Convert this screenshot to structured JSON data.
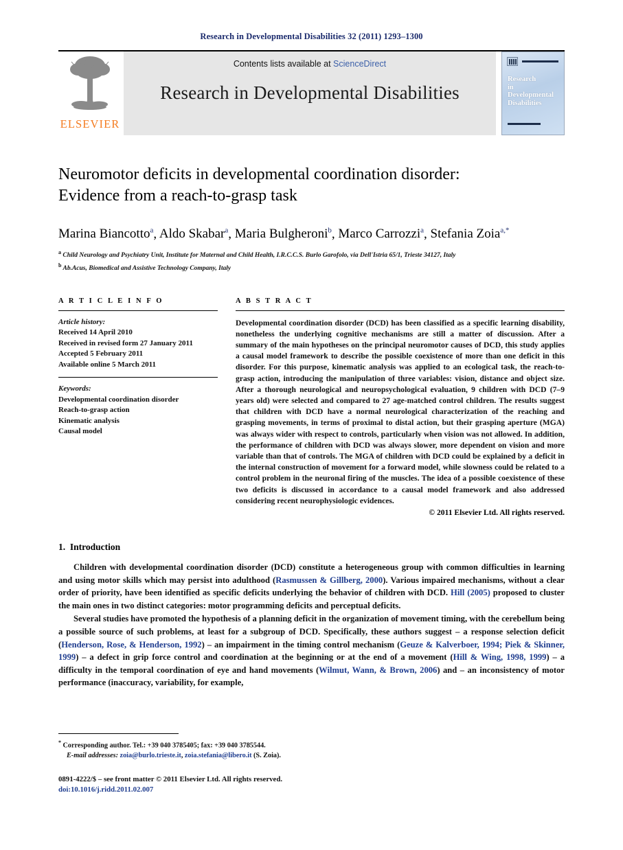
{
  "running_head": "Research in Developmental Disabilities 32 (2011) 1293–1300",
  "masthead": {
    "contents_prefix": "Contents lists available at ",
    "sciencedirect": "ScienceDirect",
    "journal_title": "Research in Developmental Disabilities",
    "publisher_wordmark": "ELSEVIER",
    "cover_title_lines": [
      "Research",
      "in",
      "Developmental",
      "Disabilities"
    ],
    "accent_orange": "#f47b20",
    "link_blue": "#3b5fa8"
  },
  "article": {
    "title_line1": "Neuromotor deficits in developmental coordination disorder:",
    "title_line2": "Evidence from a reach-to-grasp task",
    "authors": [
      {
        "name": "Marina Biancotto",
        "sup": "a",
        "sep": ", "
      },
      {
        "name": "Aldo Skabar",
        "sup": "a",
        "sep": ", "
      },
      {
        "name": "Maria Bulgheroni",
        "sup": "b",
        "sep": ", "
      },
      {
        "name": "Marco Carrozzi",
        "sup": "a",
        "sep": ", "
      },
      {
        "name": "Stefania Zoia",
        "sup": "a,*",
        "sep": ""
      }
    ],
    "affiliations": [
      {
        "marker": "a",
        "text": "Child Neurology and Psychiatry Unit, Institute for Maternal and Child Health, I.R.C.C.S. Burlo Garofolo, via Dell'Istria 65/1, Trieste 34127, Italy"
      },
      {
        "marker": "b",
        "text": "Ab.Acus, Biomedical and Assistive Technology Company, Italy"
      }
    ]
  },
  "article_info": {
    "heading": "A R T I C L E   I N F O",
    "history_label": "Article history:",
    "history": [
      "Received 14 April 2010",
      "Received in revised form 27 January 2011",
      "Accepted 5 February 2011",
      "Available online 5 March 2011"
    ],
    "keywords_label": "Keywords:",
    "keywords": [
      "Developmental coordination disorder",
      "Reach-to-grasp action",
      "Kinematic analysis",
      "Causal model"
    ]
  },
  "abstract": {
    "heading": "A B S T R A C T",
    "text": "Developmental coordination disorder (DCD) has been classified as a specific learning disability, nonetheless the underlying cognitive mechanisms are still a matter of discussion. After a summary of the main hypotheses on the principal neuromotor causes of DCD, this study applies a causal model framework to describe the possible coexistence of more than one deficit in this disorder. For this purpose, kinematic analysis was applied to an ecological task, the reach-to-grasp action, introducing the manipulation of three variables: vision, distance and object size. After a thorough neurological and neuropsychological evaluation, 9 children with DCD (7–9 years old) were selected and compared to 27 age-matched control children. The results suggest that children with DCD have a normal neurological characterization of the reaching and grasping movements, in terms of proximal to distal action, but their grasping aperture (MGA) was always wider with respect to controls, particularly when vision was not allowed. In addition, the performance of children with DCD was always slower, more dependent on vision and more variable than that of controls. The MGA of children with DCD could be explained by a deficit in the internal construction of movement for a forward model, while slowness could be related to a control problem in the neuronal firing of the muscles. The idea of a possible coexistence of these two deficits is discussed in accordance to a causal model framework and also addressed considering recent neurophysiologic evidences.",
    "copyright": "© 2011 Elsevier Ltd. All rights reserved."
  },
  "introduction": {
    "number": "1.",
    "title": "Introduction",
    "paragraph1": {
      "part1": "Children with developmental coordination disorder (DCD) constitute a heterogeneous group with common difficulties in learning and using motor skills which may persist into adulthood (",
      "cite1": "Rasmussen & Gillberg, 2000",
      "part2": "). Various impaired mechanisms, without a clear order of priority, have been identified as specific deficits underlying the behavior of children with DCD. ",
      "cite2": "Hill (2005)",
      "part3": " proposed to cluster the main ones in two distinct categories: motor programming deficits and perceptual deficits."
    },
    "paragraph2": {
      "part1": "Several studies have promoted the hypothesis of a planning deficit in the organization of movement timing, with the cerebellum being a possible source of such problems, at least for a subgroup of DCD. Specifically, these authors suggest – a response selection deficit (",
      "cite1": "Henderson, Rose, & Henderson, 1992",
      "part2": ") – an impairment in the timing control mechanism (",
      "cite2": "Geuze & Kalverboer, 1994; Piek & Skinner, 1999",
      "part3": ") – a defect in grip force control and coordination at the beginning or at the end of a movement (",
      "cite3": "Hill & Wing, 1998, 1999",
      "part4": ") – a difficulty in the temporal coordination of eye and hand movements (",
      "cite4": "Wilmut, Wann, & Brown, 2006",
      "part5": ") and – an inconsistency of motor performance (inaccuracy, variability, for example,"
    }
  },
  "footnotes": {
    "corresponding_marker": "*",
    "corresponding": "Corresponding author. Tel.: +39 040 3785405; fax: +39 040 3785544.",
    "email_label": "E-mail addresses:",
    "email1": "zoia@burlo.trieste.it",
    "email_sep": ", ",
    "email2": "zoia.stefania@libero.it",
    "email_suffix": " (S. Zoia)."
  },
  "colophon": {
    "issn_line": "0891-4222/$ – see front matter © 2011 Elsevier Ltd. All rights reserved.",
    "doi_label": "doi:",
    "doi": "10.1016/j.ridd.2011.02.007"
  }
}
